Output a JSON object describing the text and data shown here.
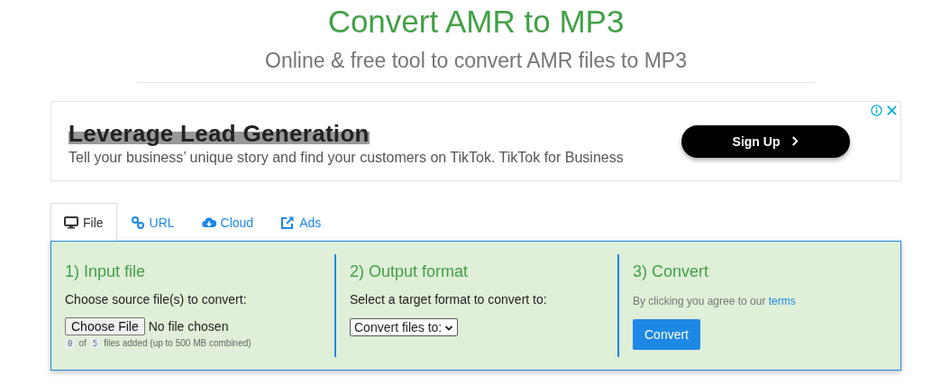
{
  "header": {
    "title": "Convert AMR to MP3",
    "subtitle": "Online & free tool to convert AMR files to MP3"
  },
  "ad": {
    "headline": "Leverage Lead Generation",
    "body": "Tell your business’ unique story and find your customers on TikTok. TikTok for Business",
    "button": "Sign Up"
  },
  "tabs": [
    {
      "label": "File",
      "kind": "file",
      "selected": true
    },
    {
      "label": "URL",
      "kind": "url",
      "selected": false
    },
    {
      "label": "Cloud",
      "kind": "cloud",
      "selected": false
    },
    {
      "label": "Ads",
      "kind": "ads",
      "selected": false
    }
  ],
  "steps": [
    {
      "kind": "input",
      "heading": "1) Input file",
      "text": "Choose source file(s) to convert:",
      "button": "Choose File",
      "status": "No file chosen",
      "count": "0",
      "of": "of",
      "max": "5",
      "note": "files added (up to 500 MB combined)"
    },
    {
      "kind": "output",
      "heading": "2) Output format",
      "text": "Select a target format to convert to:",
      "select": "Convert files to:"
    },
    {
      "kind": "convert",
      "heading": "3) Convert",
      "text": "By clicking you agree to our",
      "link": "terms",
      "button": "Convert"
    }
  ]
}
